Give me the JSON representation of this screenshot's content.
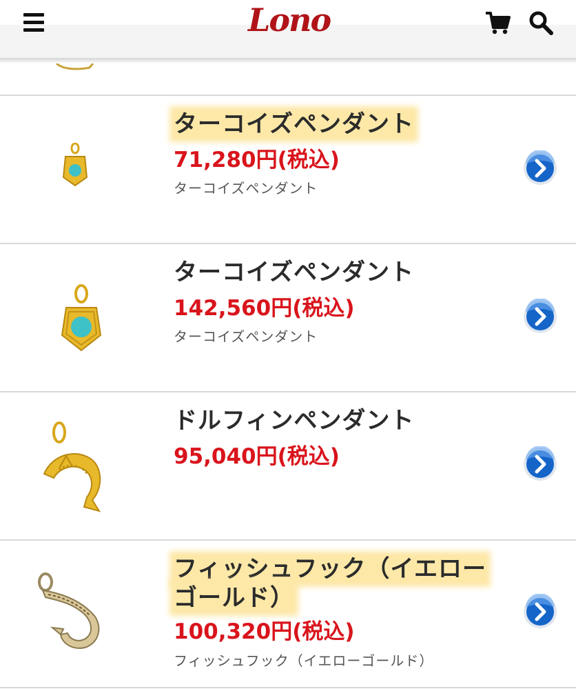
{
  "header": {
    "logo_text": "Lono",
    "menu_icon": "hamburger-icon",
    "cart_icon": "cart-icon",
    "search_icon": "search-icon"
  },
  "colors": {
    "price": "#d9141c",
    "highlight": "#fde8a8",
    "arrow_blue": "#1565c9",
    "logo_red": "#b01418"
  },
  "products": [
    {
      "name": "ターコイズペンダント",
      "price": "71,280円(税込)",
      "subtitle": "ターコイズペンダント",
      "highlighted": true
    },
    {
      "name": "ターコイズペンダント",
      "price": "142,560円(税込)",
      "subtitle": "ターコイズペンダント",
      "highlighted": false
    },
    {
      "name": "ドルフィンペンダント",
      "price": "95,040円(税込)",
      "subtitle": "",
      "highlighted": false
    },
    {
      "name_line1": "フィッシュフック（イエロー",
      "name_line2": "ゴールド）",
      "price": "100,320円(税込)",
      "subtitle": "フィッシュフック（イエローゴールド）",
      "highlighted": true
    }
  ]
}
